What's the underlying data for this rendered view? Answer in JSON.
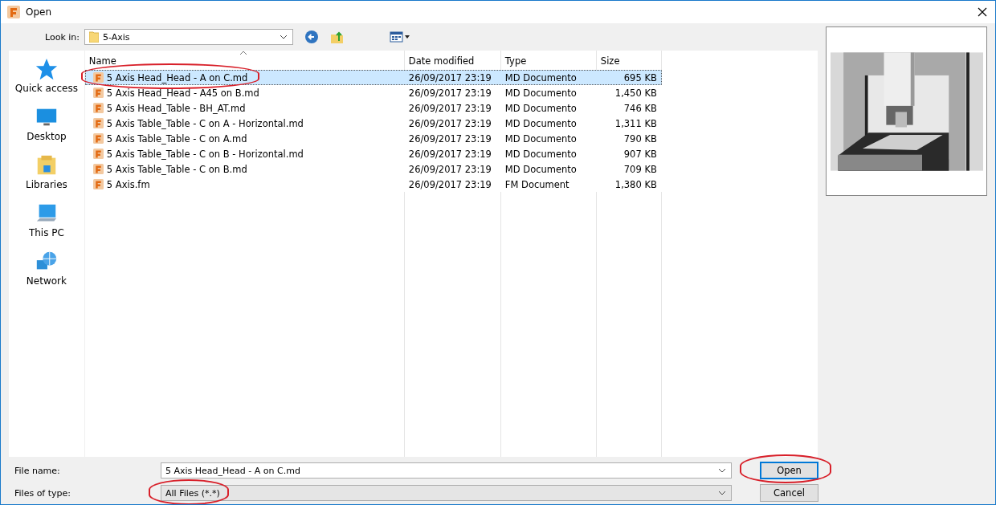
{
  "window": {
    "title": "Open"
  },
  "look_in": {
    "label": "Look in:",
    "value": "5-Axis"
  },
  "places": [
    {
      "label": "Quick access",
      "kind": "star"
    },
    {
      "label": "Desktop",
      "kind": "desktop"
    },
    {
      "label": "Libraries",
      "kind": "library"
    },
    {
      "label": "This PC",
      "kind": "pc"
    },
    {
      "label": "Network",
      "kind": "network"
    }
  ],
  "table": {
    "columns": [
      "Name",
      "Date modified",
      "Type",
      "Size"
    ],
    "rows": [
      {
        "name": "5 Axis Head_Head - A on C.md",
        "date": "26/09/2017 23:19",
        "type": "MD Documento",
        "size": "695 KB",
        "selected": true
      },
      {
        "name": "5 Axis Head_Head - A45 on B.md",
        "date": "26/09/2017 23:19",
        "type": "MD Documento",
        "size": "1,450 KB",
        "selected": false
      },
      {
        "name": "5 Axis Head_Table - BH_AT.md",
        "date": "26/09/2017 23:19",
        "type": "MD Documento",
        "size": "746 KB",
        "selected": false
      },
      {
        "name": "5 Axis Table_Table - C on A - Horizontal.md",
        "date": "26/09/2017 23:19",
        "type": "MD Documento",
        "size": "1,311 KB",
        "selected": false
      },
      {
        "name": "5 Axis Table_Table - C on A.md",
        "date": "26/09/2017 23:19",
        "type": "MD Documento",
        "size": "790 KB",
        "selected": false
      },
      {
        "name": "5 Axis Table_Table - C on B - Horizontal.md",
        "date": "26/09/2017 23:19",
        "type": "MD Documento",
        "size": "907 KB",
        "selected": false
      },
      {
        "name": "5 Axis Table_Table - C on B.md",
        "date": "26/09/2017 23:19",
        "type": "MD Documento",
        "size": "709 KB",
        "selected": false
      },
      {
        "name": "5 Axis.fm",
        "date": "26/09/2017 23:19",
        "type": "FM Document",
        "size": "1,380 KB",
        "selected": false
      }
    ]
  },
  "file_name": {
    "label": "File name:",
    "value": "5 Axis Head_Head - A on C.md"
  },
  "file_type": {
    "label": "Files of type:",
    "value": "All Files (*.*)"
  },
  "buttons": [
    "Open",
    "Cancel"
  ]
}
